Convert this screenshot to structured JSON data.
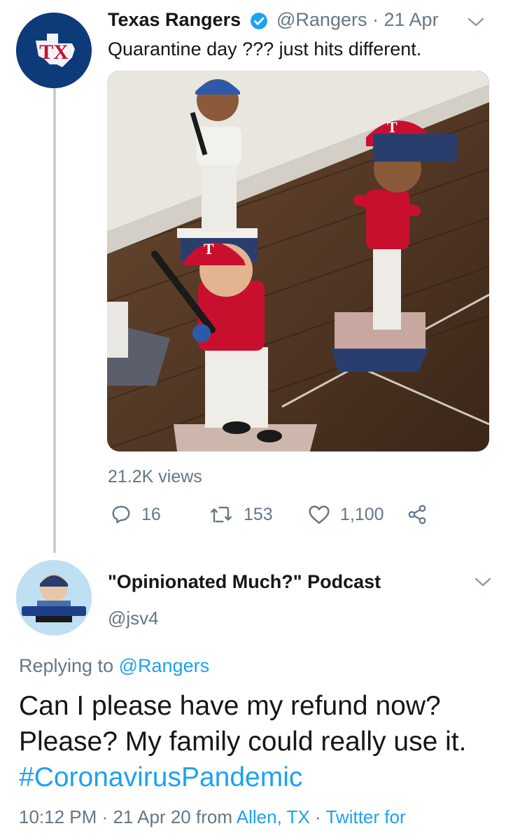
{
  "tweet": {
    "display_name": "Texas Rangers",
    "handle": "@Rangers",
    "separator": "·",
    "date": "21 Apr",
    "text": "Quarantine day ??? just hits different.",
    "media_icon": "bobblehead-figures-video",
    "views": "21.2K views",
    "replies": "16",
    "retweets": "153",
    "likes": "1,100",
    "avatar_logo_text": "TX"
  },
  "reply": {
    "display_name": "\"Opinionated Much?\" Podcast",
    "handle": "@jsv4",
    "replying_prefix": "Replying to",
    "replying_to": "@Rangers",
    "text_main": "Can I please have my refund now? Please? My family could really use it. ",
    "hashtag": "#CoronavirusPandemic",
    "time": "10:12 PM",
    "sep1": "·",
    "date": "21 Apr 20",
    "from_word": "from",
    "location": "Allen, TX",
    "sep2": "·",
    "source": "Twitter for"
  },
  "colors": {
    "link": "#1da1f2",
    "secondary_text": "#657786",
    "primary_text": "#14171a",
    "rangers_blue": "#0d3b7a",
    "rangers_red": "#c8102e"
  }
}
